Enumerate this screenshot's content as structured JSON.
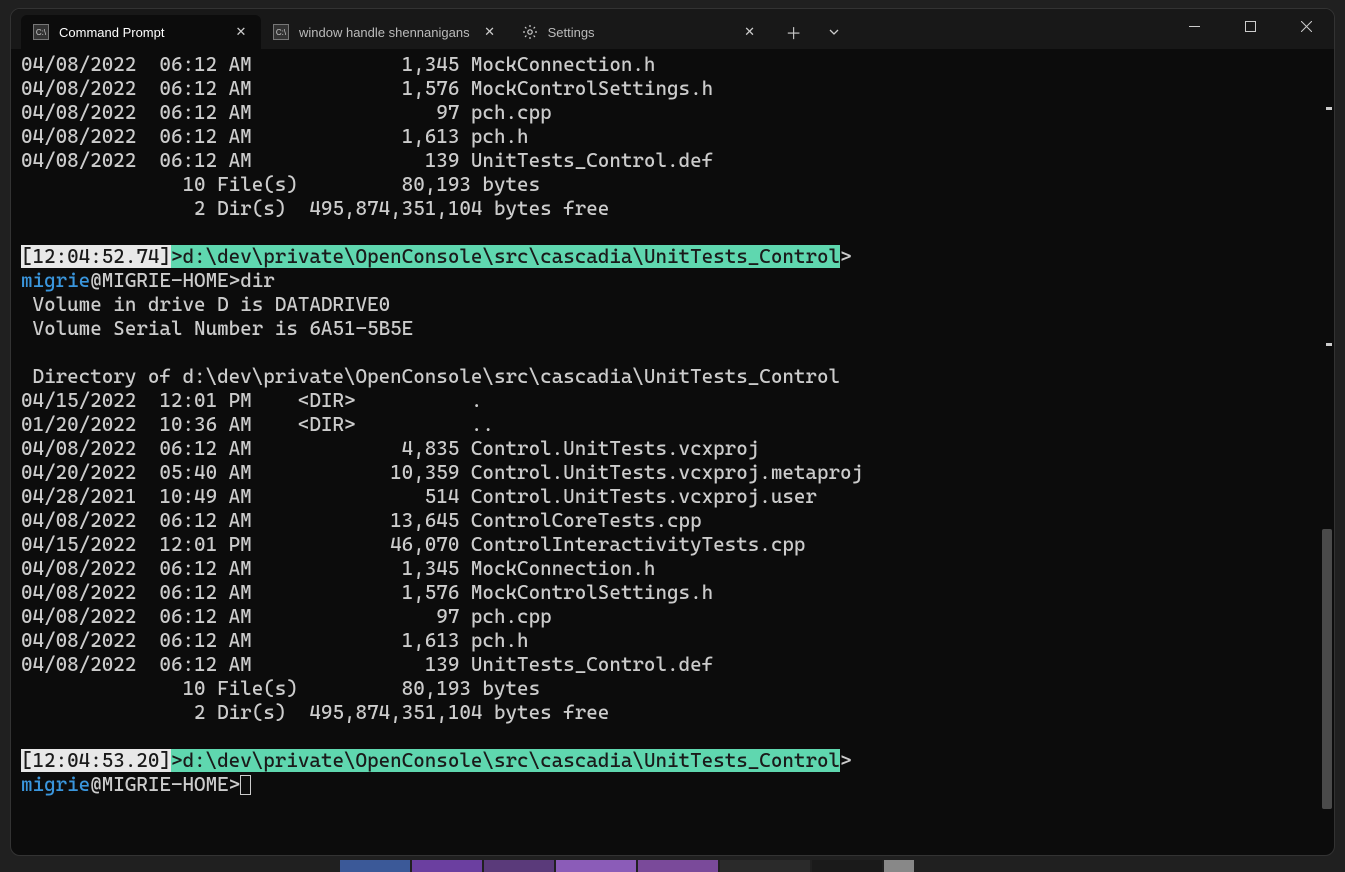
{
  "tabs": [
    {
      "label": "Command Prompt",
      "icon": "cmd-icon",
      "active": true
    },
    {
      "label": "window handle shennanigans",
      "icon": "cmd-icon",
      "active": false
    },
    {
      "label": "Settings",
      "icon": "settings-icon",
      "active": false
    }
  ],
  "prompt1": {
    "time": "[12:04:52.74]",
    "path": "d:\\dev\\private\\OpenConsole\\src\\cascadia\\UnitTests_Control",
    "user": "migrie",
    "host": "MIGRIE-HOME",
    "cmd": "dir"
  },
  "prompt2": {
    "time": "[12:04:53.20]",
    "path": "d:\\dev\\private\\OpenConsole\\src\\cascadia\\UnitTests_Control",
    "user": "migrie",
    "host": "MIGRIE-HOME",
    "cmd": ""
  },
  "top_lines": [
    "04/08/2022  06:12 AM             1,345 MockConnection.h",
    "04/08/2022  06:12 AM             1,576 MockControlSettings.h",
    "04/08/2022  06:12 AM                97 pch.cpp",
    "04/08/2022  06:12 AM             1,613 pch.h",
    "04/08/2022  06:12 AM               139 UnitTests_Control.def",
    "              10 File(s)         80,193 bytes",
    "               2 Dir(s)  495,874,351,104 bytes free"
  ],
  "vol_lines": [
    " Volume in drive D is DATADRIVE0",
    " Volume Serial Number is 6A51-5B5E",
    "",
    " Directory of d:\\dev\\private\\OpenConsole\\src\\cascadia\\UnitTests_Control",
    ""
  ],
  "dir_lines": [
    "04/15/2022  12:01 PM    <DIR>          .",
    "01/20/2022  10:36 AM    <DIR>          ..",
    "04/08/2022  06:12 AM             4,835 Control.UnitTests.vcxproj",
    "04/20/2022  05:40 AM            10,359 Control.UnitTests.vcxproj.metaproj",
    "04/28/2021  10:49 AM               514 Control.UnitTests.vcxproj.user",
    "04/08/2022  06:12 AM            13,645 ControlCoreTests.cpp",
    "04/15/2022  12:01 PM            46,070 ControlInteractivityTests.cpp",
    "04/08/2022  06:12 AM             1,345 MockConnection.h",
    "04/08/2022  06:12 AM             1,576 MockControlSettings.h",
    "04/08/2022  06:12 AM                97 pch.cpp",
    "04/08/2022  06:12 AM             1,613 pch.h",
    "04/08/2022  06:12 AM               139 UnitTests_Control.def",
    "              10 File(s)         80,193 bytes",
    "               2 Dir(s)  495,874,351,104 bytes free"
  ],
  "colors": {
    "time_bg": "#e8e8e8",
    "path_bg": "#5fd7af",
    "user_fg": "#3a96dd"
  }
}
